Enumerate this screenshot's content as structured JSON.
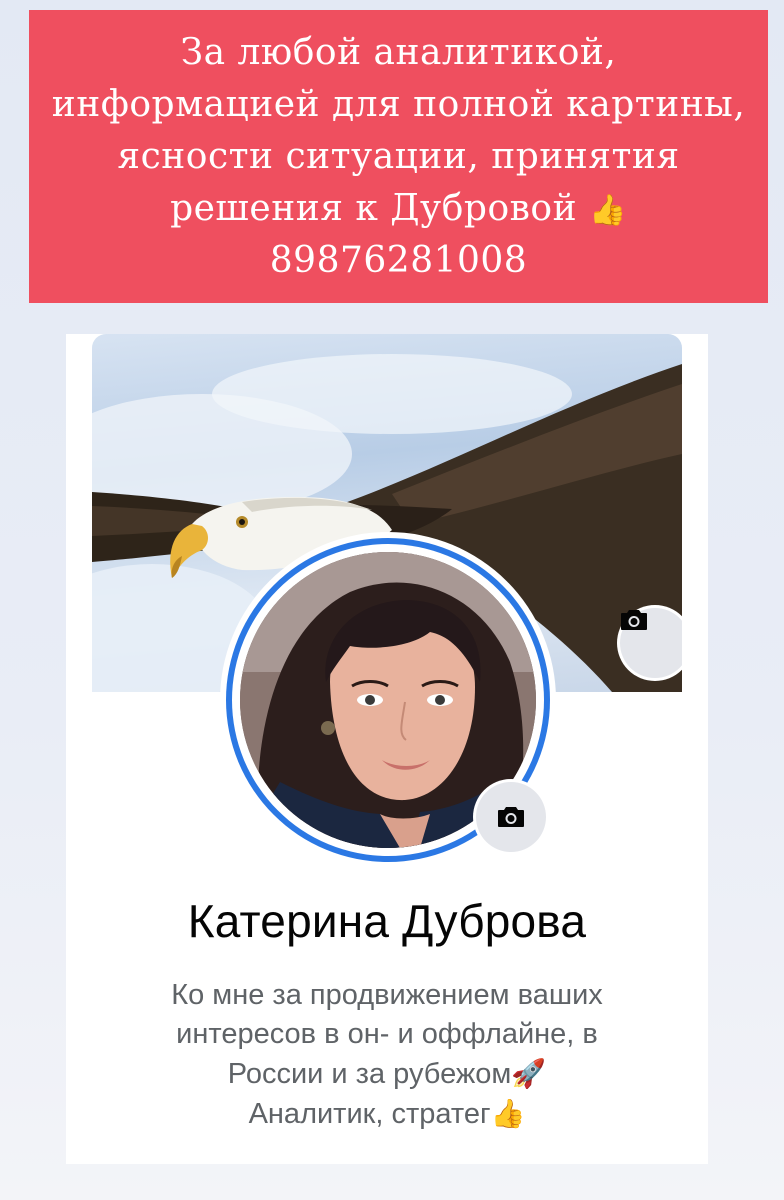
{
  "banner": {
    "text": "За любой аналитикой,\nинформацией для полной картины,\nясности ситуации, принятия\nрешения к Дубровой",
    "thumb_icon": "thumbs-up-icon",
    "phone": "89876281008",
    "background": "#ef4f5f"
  },
  "profile": {
    "cover_camera_icon": "camera-icon",
    "avatar_camera_icon": "camera-icon",
    "name": "Катерина Дуброва",
    "bio_lines": [
      "Ко мне за продвижением ваших",
      "интересов в он- и оффлайне, в",
      "России и за рубежом",
      "Аналитик, стратег"
    ],
    "bio_emojis": [
      "rocket-icon",
      "thumbs-up-icon"
    ],
    "accent_color": "#2b78e4"
  }
}
